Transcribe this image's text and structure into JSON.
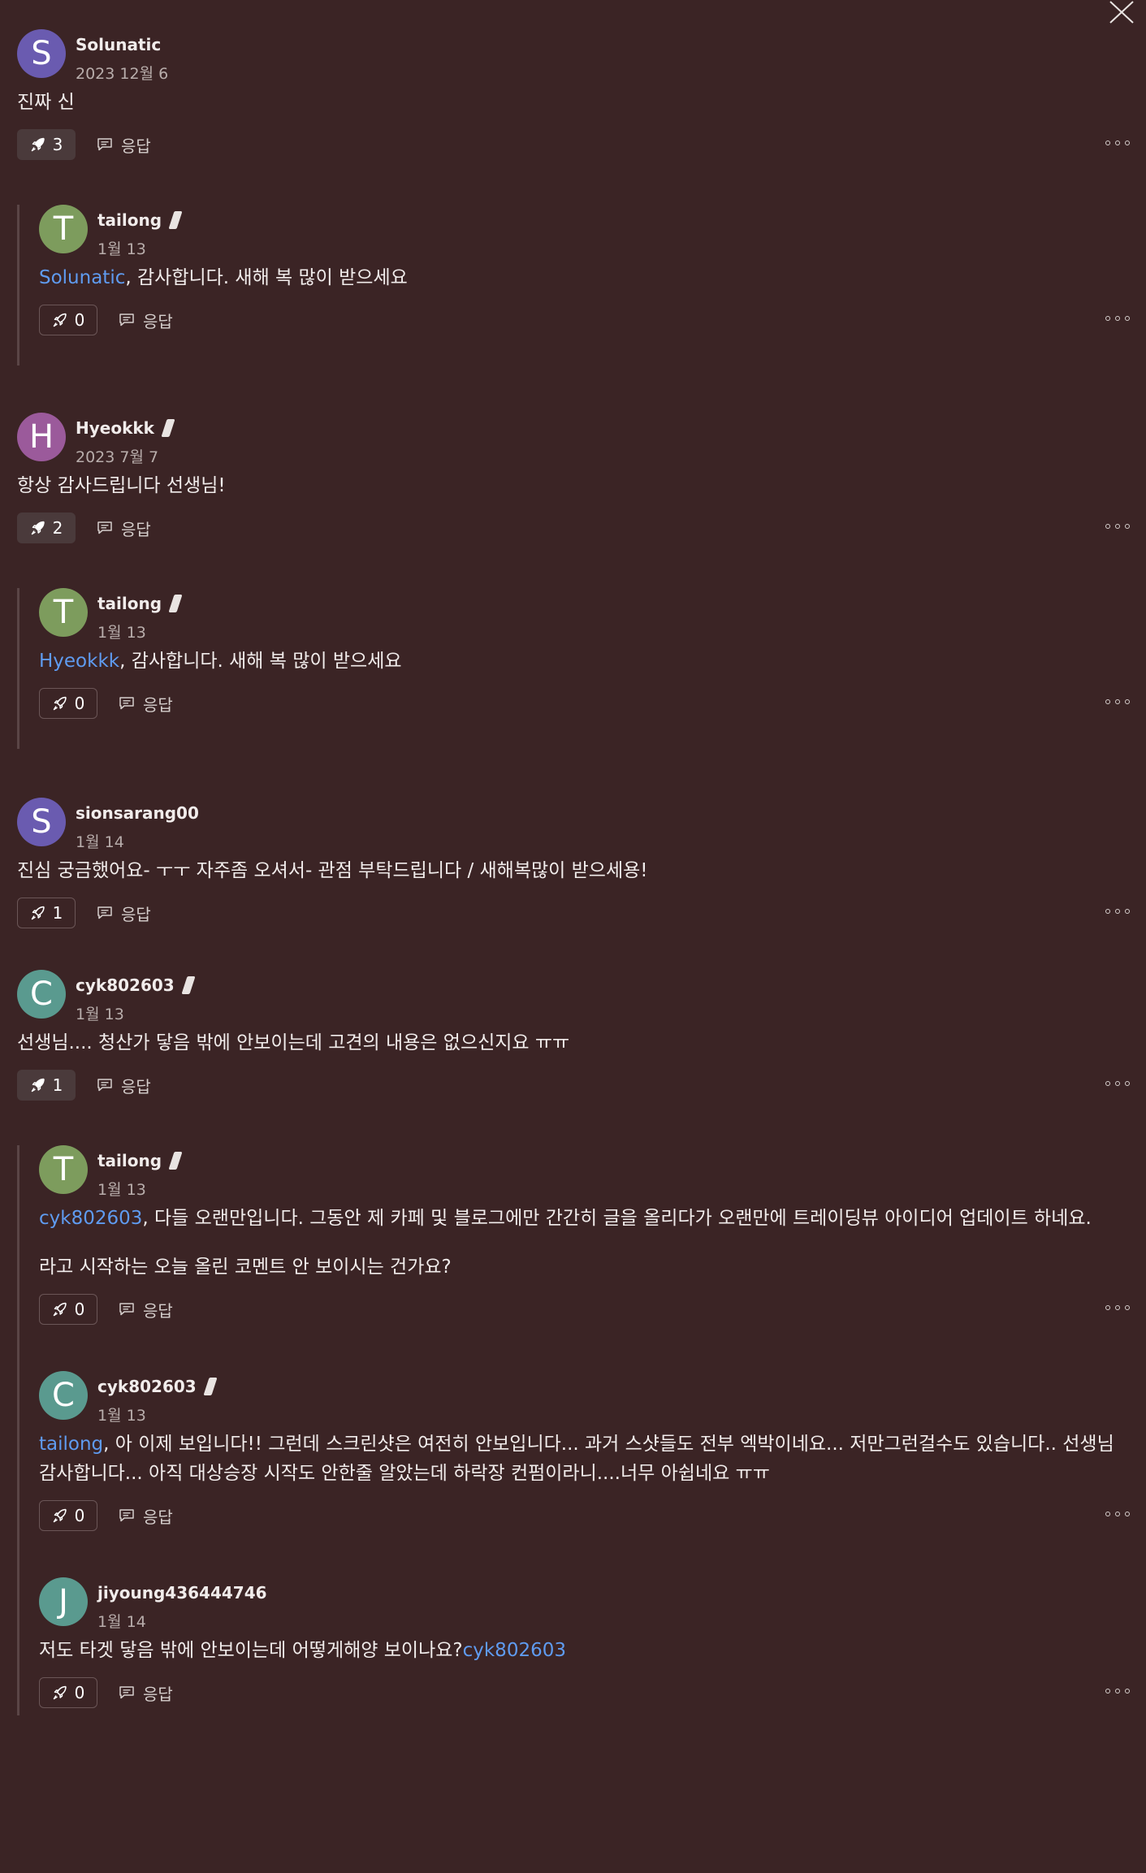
{
  "ui": {
    "reply_label": "응답"
  },
  "comments": [
    {
      "avatar": "S",
      "avatar_color": "#6a5bb0",
      "username": "Solunatic",
      "date": "2023 12월 6",
      "text": "진짜 신",
      "boosts": "3",
      "boosted": true,
      "replies": [
        {
          "avatar": "T",
          "avatar_color": "#7d9c5d",
          "username": "tailong",
          "date": "1월 13",
          "mention": "Solunatic",
          "text": ", 감사합니다. 새해 복 많이 받으세요",
          "boosts": "0"
        }
      ]
    },
    {
      "avatar": "H",
      "avatar_color": "#9b5a9b",
      "username": "Hyeokkk",
      "date": "2023 7월 7",
      "text": "항상 감사드립니다 선생님!",
      "boosts": "2",
      "boosted": true,
      "replies": [
        {
          "avatar": "T",
          "avatar_color": "#7d9c5d",
          "username": "tailong",
          "date": "1월 13",
          "mention": "Hyeokkk",
          "text": ", 감사합니다. 새해 복 많이 받으세요",
          "boosts": "0"
        }
      ]
    },
    {
      "avatar": "S",
      "avatar_color": "#6a5bb0",
      "username": "sionsarang00",
      "date": "1월 14",
      "text": "진심 궁금했어요- ㅜㅜ 자주좀 오셔서- 관점 부탁드립니다 / 새해복많이 받으세용!",
      "boosts": "1",
      "boosted": false,
      "replies": []
    },
    {
      "avatar": "C",
      "avatar_color": "#5a9a8f",
      "username": "cyk802603",
      "date": "1월 13",
      "text": "선생님.... 청산가 닿음 밖에 안보이는데 고견의 내용은 없으신지요 ㅠㅠ",
      "boosts": "1",
      "boosted": true,
      "replies": [
        {
          "avatar": "T",
          "avatar_color": "#7d9c5d",
          "username": "tailong",
          "date": "1월 13",
          "mention": "cyk802603",
          "text": ", 다들 오랜만입니다. 그동안 제 카페 및 블로그에만 간간히 글을 올리다가 오랜만에 트레이딩뷰 아이디어 업데이트 하네요.",
          "text2": "라고 시작하는 오늘 올린 코멘트 안 보이시는 건가요?",
          "boosts": "0"
        },
        {
          "avatar": "C",
          "avatar_color": "#5a9a8f",
          "username": "cyk802603",
          "date": "1월 13",
          "mention": "tailong",
          "text": ", 아 이제 보입니다!! 그런데 스크린샷은 여전히 안보입니다... 과거 스샷들도 전부 엑박이네요... 저만그런걸수도 있습니다.. 선생님 감사합니다... 아직 대상승장 시작도 안한줄 알았는데 하락장 컨펌이라니....너무 아쉽네요 ㅠㅠ",
          "boosts": "0"
        },
        {
          "avatar": "J",
          "avatar_color": "#5a9a8f",
          "username": "jiyoung436444746",
          "date": "1월 14",
          "text": "저도 타겟 닿음 밖에 안보이는데 어떻게해양 보이나요?",
          "mention_after": "cyk802603",
          "boosts": "0",
          "nobadge": true
        }
      ]
    }
  ]
}
